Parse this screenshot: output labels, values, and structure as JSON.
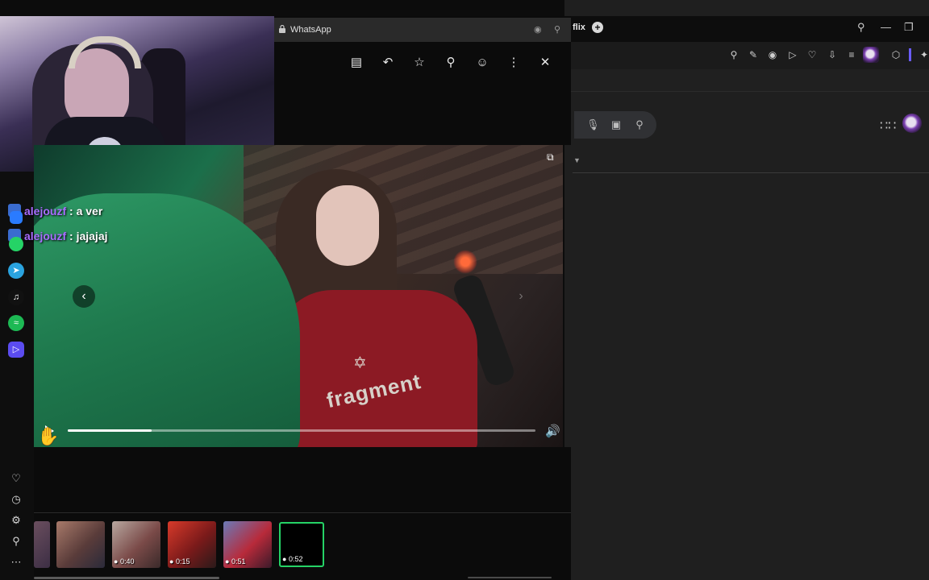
{
  "browser": {
    "tab_partial_title": "flix",
    "new_tab": "+",
    "window_controls": [
      "—",
      "❐"
    ]
  },
  "whatsapp_popup": {
    "title": "WhatsApp",
    "actions": [
      "chat-icon",
      "reply-icon",
      "star-icon",
      "pin-icon",
      "emoji-icon",
      "more-icon",
      "close-icon"
    ]
  },
  "chat": {
    "messages": [
      {
        "user": "alejouzf",
        "separator": ":",
        "text": "a ver"
      },
      {
        "user": "alejouzf",
        "separator": ":",
        "text": "jajajaj"
      }
    ]
  },
  "video": {
    "progress": 0.18,
    "prev_label": "‹",
    "next_label": "›",
    "shirt_text": "fragment"
  },
  "thumbnails": [
    {
      "duration": ""
    },
    {
      "duration": ""
    },
    {
      "duration": "0:40"
    },
    {
      "duration": "0:15"
    },
    {
      "duration": "0:51"
    },
    {
      "duration": "0:52",
      "active": true
    }
  ],
  "sidebar_apps": [
    "messenger-icon",
    "whatsapp-icon",
    "telegram-icon",
    "tiktok-icon",
    "spotify-icon",
    "video-app-icon"
  ],
  "sidebar_bottom": [
    "heart-icon",
    "clock-icon",
    "gear-icon",
    "lightbulb-icon",
    "more-icon"
  ],
  "colors": {
    "whatsapp_green": "#25d366",
    "chat_username": "#a86cff",
    "spotify": "#1db954"
  }
}
